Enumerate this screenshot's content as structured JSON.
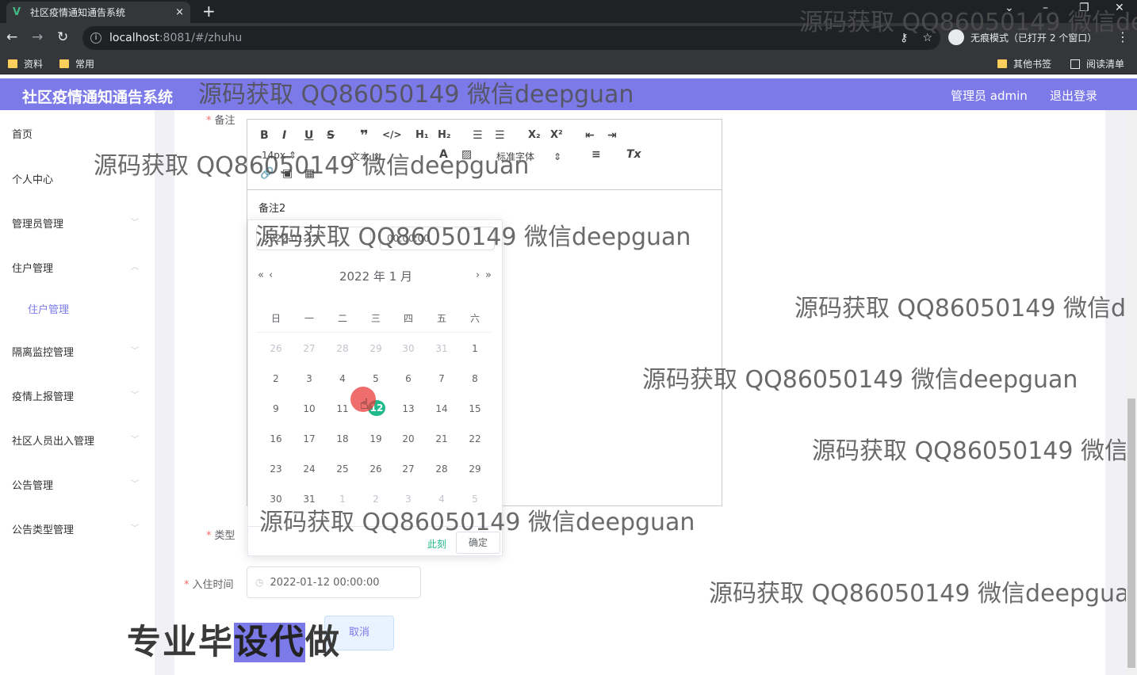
{
  "browser": {
    "tab_title": "社区疫情通知通告系统",
    "tab_favicon": "V",
    "close_glyph": "×",
    "newtab_glyph": "+",
    "url_host": "localhost",
    "url_rest": ":8081/#/zhuhu",
    "incognito_label": "无痕模式（已打开 2 个窗口）",
    "bookmarks": [
      "资料",
      "常用"
    ],
    "other_bookmarks": "其他书签",
    "reading_list": "阅读清单"
  },
  "header": {
    "title": "社区疫情通知通告系统",
    "admin_label": "管理员 admin",
    "logout_label": "退出登录"
  },
  "sidebar": {
    "items": [
      {
        "label": "首页"
      },
      {
        "label": "个人中心"
      },
      {
        "label": "管理员管理"
      },
      {
        "label": "住户管理"
      },
      {
        "label": "隔离监控管理"
      },
      {
        "label": "疫情上报管理"
      },
      {
        "label": "社区人员出入管理"
      },
      {
        "label": "公告管理"
      },
      {
        "label": "公告类型管理"
      }
    ],
    "submenu_active": "住户管理"
  },
  "form": {
    "remark_label": "备注",
    "type_label": "类型",
    "checkin_label": "入住时间",
    "editor_text": "备注2",
    "editor_font_size": "14px",
    "editor_text_style": "文本",
    "editor_font_family": "标准字体",
    "checkin_value": "2022-01-12 00:00:00",
    "cancel_label": "取消"
  },
  "picker": {
    "date_input": "2022-01-12",
    "time_input": "00:00:00",
    "header_year": "2022 年",
    "header_month": "1 月",
    "weekdays": [
      "日",
      "一",
      "二",
      "三",
      "四",
      "五",
      "六"
    ],
    "weeks": [
      [
        "26",
        "27",
        "28",
        "29",
        "30",
        "31",
        "1"
      ],
      [
        "2",
        "3",
        "4",
        "5",
        "6",
        "7",
        "8"
      ],
      [
        "9",
        "10",
        "11",
        "12",
        "13",
        "14",
        "15"
      ],
      [
        "16",
        "17",
        "18",
        "19",
        "20",
        "21",
        "22"
      ],
      [
        "23",
        "24",
        "25",
        "26",
        "27",
        "28",
        "29"
      ],
      [
        "30",
        "31",
        "1",
        "2",
        "3",
        "4",
        "5"
      ]
    ],
    "selected_day": "12",
    "now_label": "此刻",
    "confirm_label": "确定"
  },
  "overlay": {
    "promo_text_1": "专业毕",
    "promo_text_2": "设代",
    "promo_text_3": "做",
    "watermark": "源码获取 QQ86050149 微信deepguan"
  },
  "colors": {
    "header_bg": "#7b7ae8",
    "accent": "#1fb98a",
    "required": "#f56c6c"
  }
}
